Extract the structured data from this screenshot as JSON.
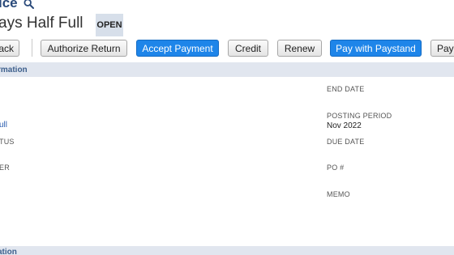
{
  "header": {
    "title": "ice",
    "record_name": "ays Half Full",
    "status": "OPEN"
  },
  "toolbar": {
    "back_label": "ack",
    "authorize_return_label": "Authorize Return",
    "accept_payment_label": "Accept Payment",
    "credit_label": "Credit",
    "renew_label": "Renew",
    "pay_with_paystand_label": "Pay with Paystand",
    "paystand_overflow_label": "Pays"
  },
  "primary_section": {
    "header": "rmation",
    "left_fields": {
      "customer_link": "ull",
      "status_label": "TUS",
      "other_label": "ER"
    },
    "right_fields": {
      "end_date_label": "END DATE",
      "posting_period_label": "POSTING PERIOD",
      "posting_period_value": "Nov 2022",
      "due_date_label": "DUE DATE",
      "po_label": "PO #",
      "memo_label": "MEMO"
    }
  },
  "secondary_section": {
    "header": "ation"
  },
  "colors": {
    "primary_button": "#1e85e9",
    "section_header_bg": "#e1e6ef",
    "status_badge_bg": "#d7dfea",
    "title": "#2a4a7a",
    "link": "#2a5db0"
  }
}
